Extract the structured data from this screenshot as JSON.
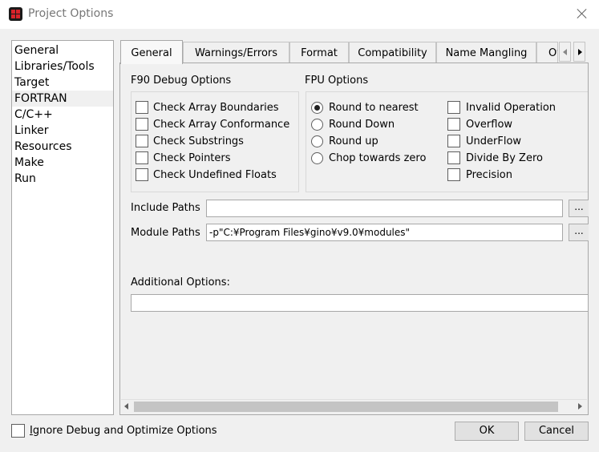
{
  "window": {
    "title": "Project Options",
    "icon": "app-grid-icon",
    "close_glyph": ""
  },
  "categories": [
    {
      "label": "General"
    },
    {
      "label": "Libraries/Tools"
    },
    {
      "label": "Target"
    },
    {
      "label": "FORTRAN",
      "selected": true
    },
    {
      "label": "C/C++"
    },
    {
      "label": "Linker"
    },
    {
      "label": "Resources"
    },
    {
      "label": "Make"
    },
    {
      "label": "Run"
    }
  ],
  "tabs": [
    {
      "label": "General",
      "active": true
    },
    {
      "label": "Warnings/Errors"
    },
    {
      "label": "Format"
    },
    {
      "label": "Compatibility"
    },
    {
      "label": "Name Mangling"
    },
    {
      "label": "Other"
    }
  ],
  "f90_debug": {
    "title": "F90 Debug Options",
    "options": [
      {
        "label": "Check Array Boundaries",
        "checked": false
      },
      {
        "label": "Check Array Conformance",
        "checked": false
      },
      {
        "label": "Check Substrings",
        "checked": false
      },
      {
        "label": "Check Pointers",
        "checked": false
      },
      {
        "label": "Check Undefined Floats",
        "checked": false
      }
    ]
  },
  "fpu": {
    "title": "FPU Options",
    "rounding": [
      {
        "label": "Round to nearest",
        "selected": true
      },
      {
        "label": "Round Down",
        "selected": false
      },
      {
        "label": "Round up",
        "selected": false
      },
      {
        "label": "Chop towards zero",
        "selected": false
      }
    ],
    "exceptions": [
      {
        "label": "Invalid Operation",
        "checked": false
      },
      {
        "label": "Overflow",
        "checked": false
      },
      {
        "label": "UnderFlow",
        "checked": false
      },
      {
        "label": "Divide By Zero",
        "checked": false
      },
      {
        "label": "Precision",
        "checked": false
      }
    ]
  },
  "paths": {
    "include_label": "Include Paths",
    "include_value": "",
    "module_label": "Module Paths",
    "module_value": "-p\"C:¥Program Files¥gino¥v9.0¥modules\"",
    "browse_label": "..."
  },
  "additional": {
    "label": "Additional Options:",
    "value": ""
  },
  "footer": {
    "ignore_label_hotkey": "I",
    "ignore_label_rest": "gnore Debug and Optimize Options",
    "ignore_checked": false,
    "ok_label": "OK",
    "cancel_label": "Cancel"
  }
}
